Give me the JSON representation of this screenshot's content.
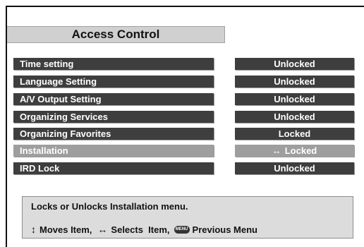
{
  "title": "Access Control",
  "rows": [
    {
      "label": "Time setting",
      "status": "Unlocked"
    },
    {
      "label": "Language Setting",
      "status": "Unlocked"
    },
    {
      "label": "A/V Output Setting",
      "status": "Unlocked"
    },
    {
      "label": "Organizing Services",
      "status": "Unlocked"
    },
    {
      "label": "Organizing Favorites",
      "status": "Locked"
    },
    {
      "label": "Installation",
      "status": "Locked"
    },
    {
      "label": "IRD Lock",
      "status": "Unlocked"
    }
  ],
  "selected_row": "Installation",
  "selected_arrow": "↔",
  "help": {
    "description": "Locks or Unlocks Installation menu.",
    "updown_icon": "↕",
    "moves": "Moves Item,",
    "leftright_icon": "↔",
    "selects": "Selects  Item,",
    "menu_icon": "MENU",
    "previous": "Previous Menu"
  }
}
